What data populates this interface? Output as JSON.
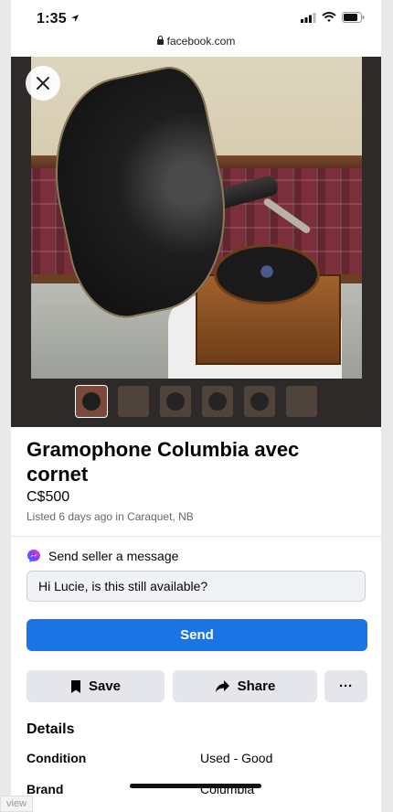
{
  "status_bar": {
    "time": "1:35"
  },
  "browser": {
    "url": "facebook.com"
  },
  "listing": {
    "title": "Gramophone Columbia avec cornet",
    "price": "C$500",
    "listed": "Listed 6 days ago in Caraquet, NB",
    "thumbnail_count": 6,
    "active_thumbnail": 1
  },
  "message": {
    "header": "Send seller a message",
    "input_value": "Hi Lucie, is this still available?",
    "send_label": "Send"
  },
  "actions": {
    "save_label": "Save",
    "share_label": "Share",
    "more_label": "···"
  },
  "details": {
    "heading": "Details",
    "rows": [
      {
        "label": "Condition",
        "value": "Used - Good"
      },
      {
        "label": "Brand",
        "value": "Columbia"
      }
    ]
  },
  "footer": {
    "view_tag": "view"
  },
  "colors": {
    "primary": "#1b74e4",
    "secondary_button": "#e4e6eb",
    "messenger": "#a033ff"
  },
  "icons": [
    "location-arrow-icon",
    "signal-icon",
    "wifi-icon",
    "battery-icon",
    "lock-icon",
    "close-icon",
    "messenger-icon",
    "bookmark-icon",
    "share-arrow-icon",
    "more-icon"
  ]
}
